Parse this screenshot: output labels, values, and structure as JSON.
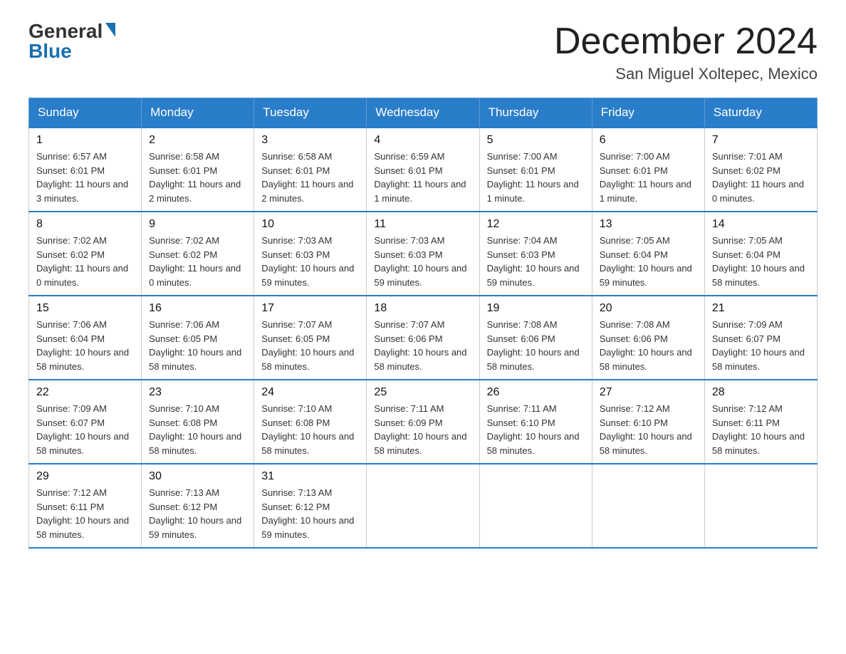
{
  "logo": {
    "general": "General",
    "blue": "Blue"
  },
  "title": "December 2024",
  "location": "San Miguel Xoltepec, Mexico",
  "weekdays": [
    "Sunday",
    "Monday",
    "Tuesday",
    "Wednesday",
    "Thursday",
    "Friday",
    "Saturday"
  ],
  "weeks": [
    [
      {
        "day": "1",
        "sunrise": "6:57 AM",
        "sunset": "6:01 PM",
        "daylight": "11 hours and 3 minutes."
      },
      {
        "day": "2",
        "sunrise": "6:58 AM",
        "sunset": "6:01 PM",
        "daylight": "11 hours and 2 minutes."
      },
      {
        "day": "3",
        "sunrise": "6:58 AM",
        "sunset": "6:01 PM",
        "daylight": "11 hours and 2 minutes."
      },
      {
        "day": "4",
        "sunrise": "6:59 AM",
        "sunset": "6:01 PM",
        "daylight": "11 hours and 1 minute."
      },
      {
        "day": "5",
        "sunrise": "7:00 AM",
        "sunset": "6:01 PM",
        "daylight": "11 hours and 1 minute."
      },
      {
        "day": "6",
        "sunrise": "7:00 AM",
        "sunset": "6:01 PM",
        "daylight": "11 hours and 1 minute."
      },
      {
        "day": "7",
        "sunrise": "7:01 AM",
        "sunset": "6:02 PM",
        "daylight": "11 hours and 0 minutes."
      }
    ],
    [
      {
        "day": "8",
        "sunrise": "7:02 AM",
        "sunset": "6:02 PM",
        "daylight": "11 hours and 0 minutes."
      },
      {
        "day": "9",
        "sunrise": "7:02 AM",
        "sunset": "6:02 PM",
        "daylight": "11 hours and 0 minutes."
      },
      {
        "day": "10",
        "sunrise": "7:03 AM",
        "sunset": "6:03 PM",
        "daylight": "10 hours and 59 minutes."
      },
      {
        "day": "11",
        "sunrise": "7:03 AM",
        "sunset": "6:03 PM",
        "daylight": "10 hours and 59 minutes."
      },
      {
        "day": "12",
        "sunrise": "7:04 AM",
        "sunset": "6:03 PM",
        "daylight": "10 hours and 59 minutes."
      },
      {
        "day": "13",
        "sunrise": "7:05 AM",
        "sunset": "6:04 PM",
        "daylight": "10 hours and 59 minutes."
      },
      {
        "day": "14",
        "sunrise": "7:05 AM",
        "sunset": "6:04 PM",
        "daylight": "10 hours and 58 minutes."
      }
    ],
    [
      {
        "day": "15",
        "sunrise": "7:06 AM",
        "sunset": "6:04 PM",
        "daylight": "10 hours and 58 minutes."
      },
      {
        "day": "16",
        "sunrise": "7:06 AM",
        "sunset": "6:05 PM",
        "daylight": "10 hours and 58 minutes."
      },
      {
        "day": "17",
        "sunrise": "7:07 AM",
        "sunset": "6:05 PM",
        "daylight": "10 hours and 58 minutes."
      },
      {
        "day": "18",
        "sunrise": "7:07 AM",
        "sunset": "6:06 PM",
        "daylight": "10 hours and 58 minutes."
      },
      {
        "day": "19",
        "sunrise": "7:08 AM",
        "sunset": "6:06 PM",
        "daylight": "10 hours and 58 minutes."
      },
      {
        "day": "20",
        "sunrise": "7:08 AM",
        "sunset": "6:06 PM",
        "daylight": "10 hours and 58 minutes."
      },
      {
        "day": "21",
        "sunrise": "7:09 AM",
        "sunset": "6:07 PM",
        "daylight": "10 hours and 58 minutes."
      }
    ],
    [
      {
        "day": "22",
        "sunrise": "7:09 AM",
        "sunset": "6:07 PM",
        "daylight": "10 hours and 58 minutes."
      },
      {
        "day": "23",
        "sunrise": "7:10 AM",
        "sunset": "6:08 PM",
        "daylight": "10 hours and 58 minutes."
      },
      {
        "day": "24",
        "sunrise": "7:10 AM",
        "sunset": "6:08 PM",
        "daylight": "10 hours and 58 minutes."
      },
      {
        "day": "25",
        "sunrise": "7:11 AM",
        "sunset": "6:09 PM",
        "daylight": "10 hours and 58 minutes."
      },
      {
        "day": "26",
        "sunrise": "7:11 AM",
        "sunset": "6:10 PM",
        "daylight": "10 hours and 58 minutes."
      },
      {
        "day": "27",
        "sunrise": "7:12 AM",
        "sunset": "6:10 PM",
        "daylight": "10 hours and 58 minutes."
      },
      {
        "day": "28",
        "sunrise": "7:12 AM",
        "sunset": "6:11 PM",
        "daylight": "10 hours and 58 minutes."
      }
    ],
    [
      {
        "day": "29",
        "sunrise": "7:12 AM",
        "sunset": "6:11 PM",
        "daylight": "10 hours and 58 minutes."
      },
      {
        "day": "30",
        "sunrise": "7:13 AM",
        "sunset": "6:12 PM",
        "daylight": "10 hours and 59 minutes."
      },
      {
        "day": "31",
        "sunrise": "7:13 AM",
        "sunset": "6:12 PM",
        "daylight": "10 hours and 59 minutes."
      },
      null,
      null,
      null,
      null
    ]
  ],
  "labels": {
    "sunrise": "Sunrise:",
    "sunset": "Sunset:",
    "daylight": "Daylight:"
  }
}
